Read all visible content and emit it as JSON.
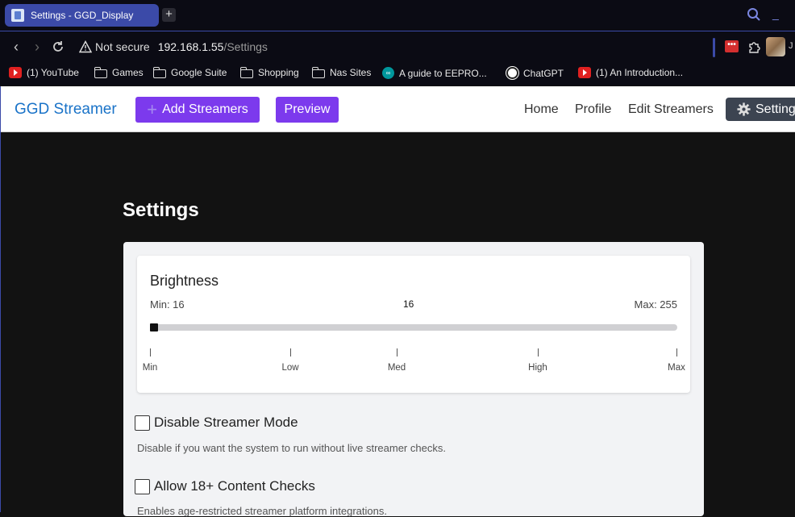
{
  "browser": {
    "tab_title": "Settings - GGD_Display",
    "new_tab": "+",
    "not_secure": "Not secure",
    "host": "192.168.1.55",
    "path": "/Settings",
    "red_extension_label": "•••",
    "accent_color": "#3b4aa8"
  },
  "bookmarks": [
    {
      "label": "(1) YouTube",
      "icon": "youtube-icon"
    },
    {
      "label": "Games",
      "icon": "folder-icon"
    },
    {
      "label": "Google Suite",
      "icon": "folder-icon"
    },
    {
      "label": "Shopping",
      "icon": "folder-icon"
    },
    {
      "label": "Nas Sites",
      "icon": "folder-icon"
    },
    {
      "label": "A guide to EEPRO...",
      "icon": "arduino-icon"
    },
    {
      "label": "ChatGPT",
      "icon": "chatgpt-icon"
    },
    {
      "label": "(1) An Introduction...",
      "icon": "youtube-icon"
    }
  ],
  "navbar": {
    "brand": "GGD Streamer",
    "add_streamers": "Add Streamers",
    "preview": "Preview",
    "home": "Home",
    "profile": "Profile",
    "edit_streamers": "Edit Streamers",
    "settings": "Settings",
    "brand_color": "#1a73c8",
    "button_color": "#7c3aed"
  },
  "main": {
    "title": "Settings",
    "brightness": {
      "title": "Brightness",
      "min_label": "Min: 16",
      "max_label": "Max: 255",
      "current_value": "16",
      "min": 16,
      "max": 255,
      "value": 16,
      "ticks": [
        "Min",
        "Low",
        "Med",
        "High",
        "Max"
      ]
    },
    "options": [
      {
        "label": "Disable Streamer Mode",
        "description": "Disable if you want the system to run without live streamer checks.",
        "checked": false
      },
      {
        "label": "Allow 18+ Content Checks",
        "description": "Enables age-restricted streamer platform integrations.",
        "checked": false
      }
    ]
  }
}
